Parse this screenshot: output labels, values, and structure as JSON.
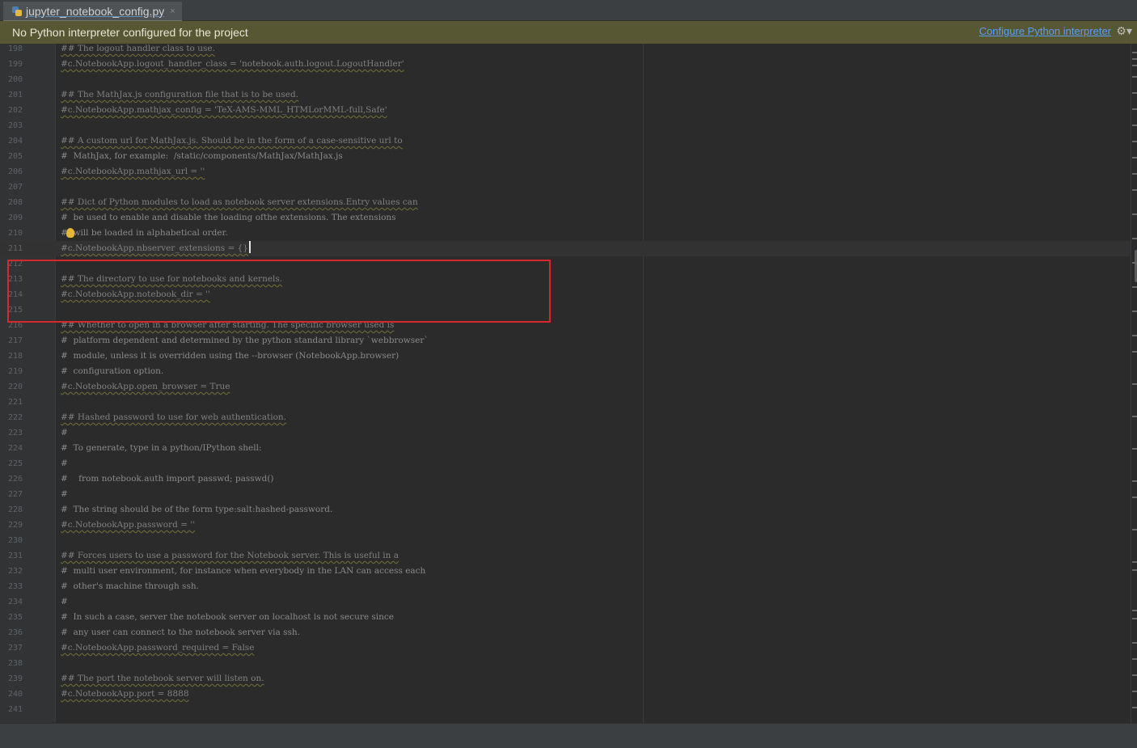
{
  "tab": {
    "label": "jupyter_notebook_config.py",
    "close": "×"
  },
  "banner": {
    "message": "No Python interpreter configured for the project",
    "link": "Configure Python interpreter"
  },
  "lines": [
    {
      "n": "198",
      "t": "## The logout handler class to use.",
      "hl": true
    },
    {
      "n": "199",
      "t": "#c.NotebookApp.logout_handler_class = 'notebook.auth.logout.LogoutHandler'",
      "hl": true
    },
    {
      "n": "200",
      "t": "",
      "hl": false
    },
    {
      "n": "201",
      "t": "## The MathJax.js configuration file that is to be used.",
      "hl": true
    },
    {
      "n": "202",
      "t": "#c.NotebookApp.mathjax_config = 'TeX-AMS-MML_HTMLorMML-full,Safe'",
      "hl": true
    },
    {
      "n": "203",
      "t": "",
      "hl": false
    },
    {
      "n": "204",
      "t": "## A custom url for MathJax.js. Should be in the form of a case-sensitive url to",
      "hl": true
    },
    {
      "n": "205",
      "t": "#  MathJax, for example:  /static/components/MathJax/MathJax.js",
      "hl": false
    },
    {
      "n": "206",
      "t": "#c.NotebookApp.mathjax_url = ''",
      "hl": true
    },
    {
      "n": "207",
      "t": "",
      "hl": false
    },
    {
      "n": "208",
      "t": "## Dict of Python modules to load as notebook server extensions.Entry values can",
      "hl": true
    },
    {
      "n": "209",
      "t": "#  be used to enable and disable the loading ofthe extensions. The extensions",
      "hl": false
    },
    {
      "n": "210",
      "t": "#  will be loaded in alphabetical order.",
      "hl": false
    },
    {
      "n": "211",
      "t": "#c.NotebookApp.nbserver_extensions = {}",
      "hl": true
    },
    {
      "n": "212",
      "t": "",
      "hl": false
    },
    {
      "n": "213",
      "t": "## The directory to use for notebooks and kernels.",
      "hl": true
    },
    {
      "n": "214",
      "t": "#c.NotebookApp.notebook_dir = ''",
      "hl": true
    },
    {
      "n": "215",
      "t": "",
      "hl": false
    },
    {
      "n": "216",
      "t": "## Whether to open in a browser after starting. The specific browser used is",
      "hl": true
    },
    {
      "n": "217",
      "t": "#  platform dependent and determined by the python standard library `webbrowser`",
      "hl": false
    },
    {
      "n": "218",
      "t": "#  module, unless it is overridden using the --browser (NotebookApp.browser)",
      "hl": false
    },
    {
      "n": "219",
      "t": "#  configuration option.",
      "hl": false
    },
    {
      "n": "220",
      "t": "#c.NotebookApp.open_browser = True",
      "hl": true
    },
    {
      "n": "221",
      "t": "",
      "hl": false
    },
    {
      "n": "222",
      "t": "## Hashed password to use for web authentication.",
      "hl": true
    },
    {
      "n": "223",
      "t": "#",
      "hl": false
    },
    {
      "n": "224",
      "t": "#  To generate, type in a python/IPython shell:",
      "hl": false
    },
    {
      "n": "225",
      "t": "#",
      "hl": false
    },
    {
      "n": "226",
      "t": "#    from notebook.auth import passwd; passwd()",
      "hl": false
    },
    {
      "n": "227",
      "t": "#",
      "hl": false
    },
    {
      "n": "228",
      "t": "#  The string should be of the form type:salt:hashed-password.",
      "hl": false
    },
    {
      "n": "229",
      "t": "#c.NotebookApp.password = ''",
      "hl": true
    },
    {
      "n": "230",
      "t": "",
      "hl": false
    },
    {
      "n": "231",
      "t": "## Forces users to use a password for the Notebook server. This is useful in a",
      "hl": true
    },
    {
      "n": "232",
      "t": "#  multi user environment, for instance when everybody in the LAN can access each",
      "hl": false
    },
    {
      "n": "233",
      "t": "#  other's machine through ssh.",
      "hl": false
    },
    {
      "n": "234",
      "t": "#",
      "hl": false
    },
    {
      "n": "235",
      "t": "#  In such a case, server the notebook server on localhost is not secure since",
      "hl": false
    },
    {
      "n": "236",
      "t": "#  any user can connect to the notebook server via ssh.",
      "hl": false
    },
    {
      "n": "237",
      "t": "#c.NotebookApp.password_required = False",
      "hl": true
    },
    {
      "n": "238",
      "t": "",
      "hl": false
    },
    {
      "n": "239",
      "t": "## The port the notebook server will listen on.",
      "hl": true
    },
    {
      "n": "240",
      "t": "#c.NotebookApp.port = 8888",
      "hl": true
    },
    {
      "n": "241",
      "t": "",
      "hl": false
    }
  ]
}
